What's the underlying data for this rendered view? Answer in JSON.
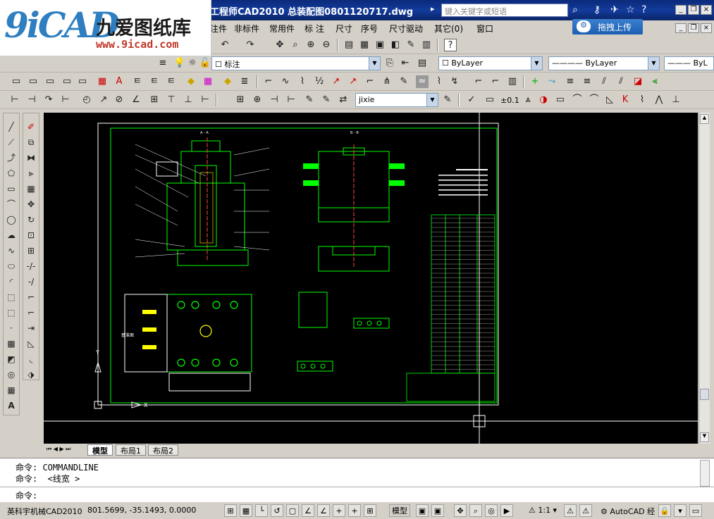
{
  "window": {
    "title": "工程师CAD2010  总装配图0801120717.dwg",
    "search_placeholder": "键入关键字或短语"
  },
  "logo": {
    "big": "9iCAD",
    "cn": "九爱图纸库",
    "url": "www.9icad.com"
  },
  "menu": [
    "注件",
    "非标件",
    "常用件",
    "标 注",
    "尺寸",
    "序号",
    "尺寸驱动",
    "其它(0)",
    "窗口"
  ],
  "upload": {
    "label": "拖拽上传"
  },
  "toolbar": {
    "annotation_label": "标注",
    "layer_combo": "ByLayer",
    "linetype_combo": "ByLayer",
    "lineweight_combo": "ByL",
    "textstyle_combo": "jixie",
    "dim_label": "±0.1"
  },
  "tabs": [
    "模型",
    "布局1",
    "布局2"
  ],
  "command": {
    "line1": "命令: COMMANDLINE",
    "line2": "命令:  <线宽 >",
    "line3": "命令:"
  },
  "status": {
    "app": "英科宇机械CAD2010",
    "coords": "801.5699,  -35.1493, 0.0000",
    "model": "模型",
    "scale": "1:1",
    "workspace": "AutoCAD 经"
  },
  "drawing": {
    "section_a": "A - A",
    "section_b": "B - B",
    "base_label": "基准面"
  }
}
